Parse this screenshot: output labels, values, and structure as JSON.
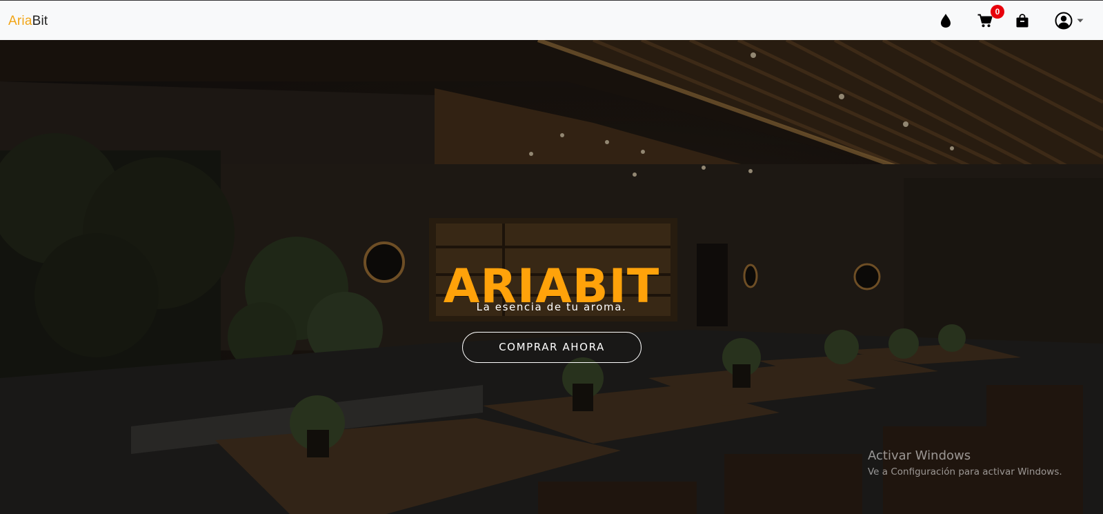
{
  "navbar": {
    "brand_part1": "Aria",
    "brand_part2": "Bit",
    "cart_count": "0",
    "colors": {
      "background": "#f8f9fa",
      "brand_accent": "#f2a516",
      "badge": "#e8000b"
    },
    "icons": [
      "drop-icon",
      "cart-icon",
      "shopping-bag-icon",
      "user-circle-icon",
      "caret-down-icon"
    ]
  },
  "hero": {
    "title": "ARIABIT",
    "subtitle": "La esencia de tu aroma.",
    "cta_label": "COMPRAR AHORA",
    "colors": {
      "title": "#ffa20a",
      "text": "#ffffff"
    }
  },
  "watermark": {
    "line1": "Activar Windows",
    "line2": "Ve a Configuración para activar Windows."
  }
}
